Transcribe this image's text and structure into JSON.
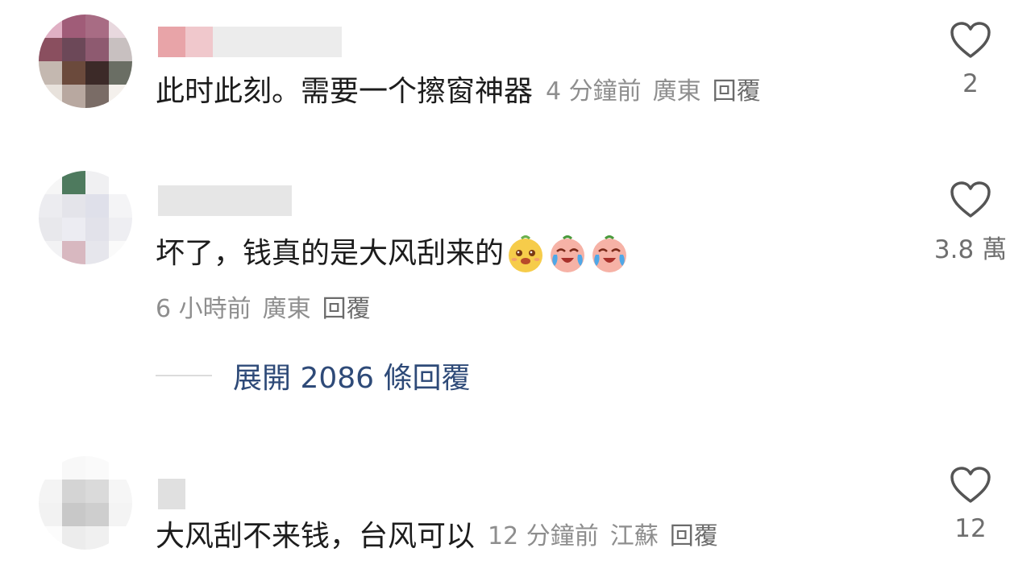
{
  "comments": [
    {
      "text": "此时此刻。需要一个擦窗神器",
      "time": "4 分鐘前",
      "location": "廣東",
      "reply_label": "回覆",
      "likes": "2"
    },
    {
      "text": "坏了，钱真的是大风刮来的",
      "time": "6 小時前",
      "location": "廣東",
      "reply_label": "回覆",
      "likes": "3.8 萬",
      "emojis": [
        "happy-face-emoji",
        "crying-laugh-emoji",
        "crying-laugh-emoji"
      ],
      "expand_label": "展開 2086 條回覆"
    },
    {
      "text": "大风刮不来钱，台风可以",
      "time": "12 分鐘前",
      "location": "江蘇",
      "reply_label": "回覆",
      "likes": "12"
    }
  ],
  "colors": {
    "text": "#1c1c1c",
    "meta": "#8e8e8e",
    "expand_link": "#2e4a78",
    "heart_outline": "#555555"
  }
}
